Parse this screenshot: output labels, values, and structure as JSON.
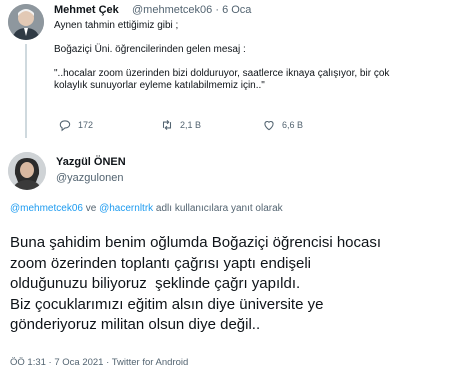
{
  "quoted_tweet": {
    "name": "Mehmet Çek",
    "handle": "@mehmetcek06",
    "separator": "·",
    "date": "6 Oca",
    "lines": [
      "Aynen tahmin ettiğimiz gibi ;",
      "",
      "Boğaziçi Üni. öğrencilerinden gelen mesaj :",
      "",
      "\"..hocalar zoom üzerinden bizi dolduruyor, saatlerce iknaya çalışıyor, bir çok",
      "kolaylık sunuyorlar eyleme katılabilmemiz için..\""
    ],
    "stats": {
      "replies": "172",
      "retweets": "2,1 B",
      "likes": "6,6 B"
    }
  },
  "reply_tweet": {
    "name": "Yazgül ÖNEN",
    "handle": "@yazgulonen",
    "replying_to": {
      "user1": "@mehmetcek06",
      "conj": " ve ",
      "user2": "@hacernltrk",
      "suffix": " adlı kullanıcılara yanıt olarak"
    },
    "lines": [
      "Buna şahidim benim oğlumda Boğaziçi öğrencisi hocası",
      "zoom özerinden toplantı çağrısı yaptı endişeli",
      "olduğunuzu biliyoruz  şeklinde çağrı yapıldı.",
      "Biz çocuklarımızı eğitim alsın diye üniversite ye",
      "gönderiyoruz militan olsun diye değil.."
    ],
    "footer": "ÖÖ 1:31 · 7 Oca 2021 · Twitter for Android"
  },
  "colors": {
    "link": "#1d9bf0",
    "muted": "#536471",
    "text": "#0f1419"
  },
  "icons": [
    "reply-icon",
    "retweet-icon",
    "like-icon"
  ]
}
